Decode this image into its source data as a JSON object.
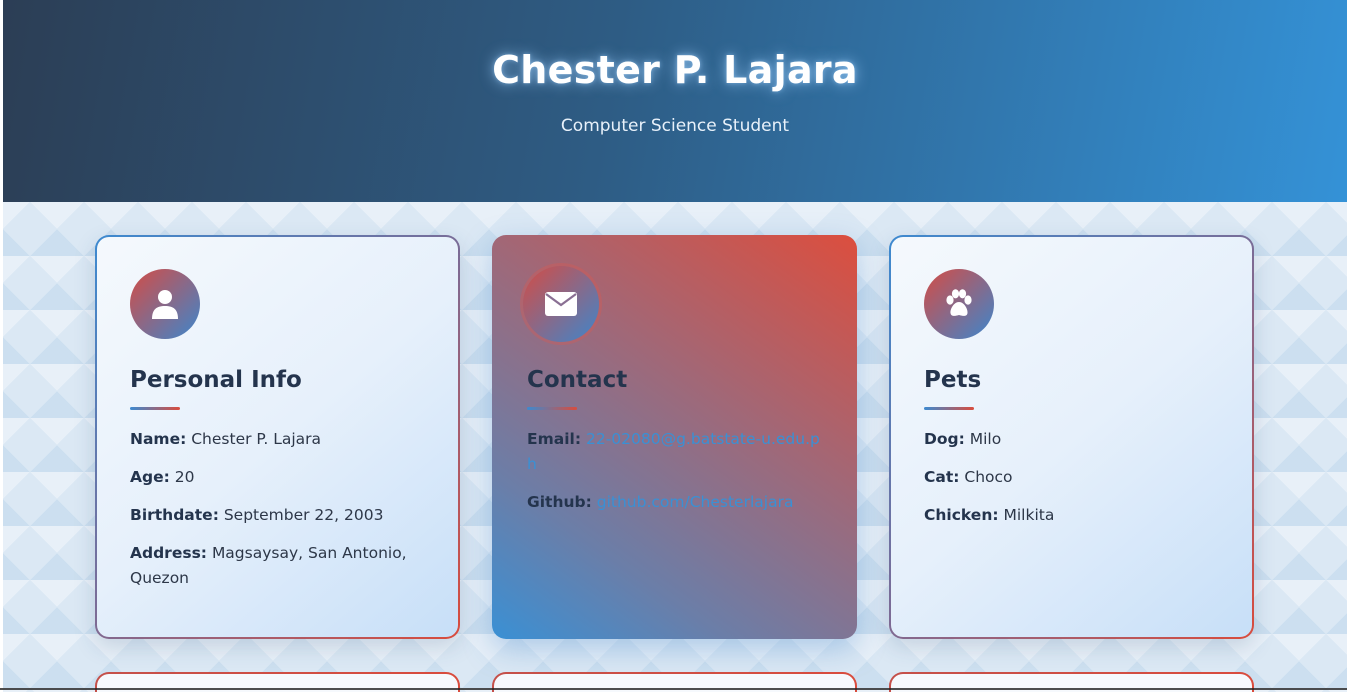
{
  "header": {
    "title": "Chester P. Lajara",
    "subtitle": "Computer Science Student"
  },
  "cards": [
    {
      "icon": "user-icon",
      "title": "Personal Info",
      "fields": [
        {
          "label": "Name:",
          "value": "Chester P. Lajara"
        },
        {
          "label": "Age:",
          "value": "20"
        },
        {
          "label": "Birthdate:",
          "value": "September 22, 2003"
        },
        {
          "label": "Address:",
          "value": "Magsaysay, San Antonio, Quezon"
        }
      ]
    },
    {
      "icon": "envelope-icon",
      "title": "Contact",
      "fields": [
        {
          "label": "Email:",
          "value": "22-02080@g.batstate-u.edu.ph"
        },
        {
          "label": "Github:",
          "value": "github.com/Chesterlajara"
        }
      ]
    },
    {
      "icon": "paw-icon",
      "title": "Pets",
      "fields": [
        {
          "label": "Dog:",
          "value": "Milo"
        },
        {
          "label": "Cat:",
          "value": "Choco"
        },
        {
          "label": "Chicken:",
          "value": "Milkita"
        }
      ]
    }
  ],
  "colors": {
    "header_start": "#2c3e55",
    "header_end": "#3492d7",
    "accent_red": "#d94c3d",
    "accent_blue": "#3d8ad0",
    "heading": "#24344d"
  }
}
